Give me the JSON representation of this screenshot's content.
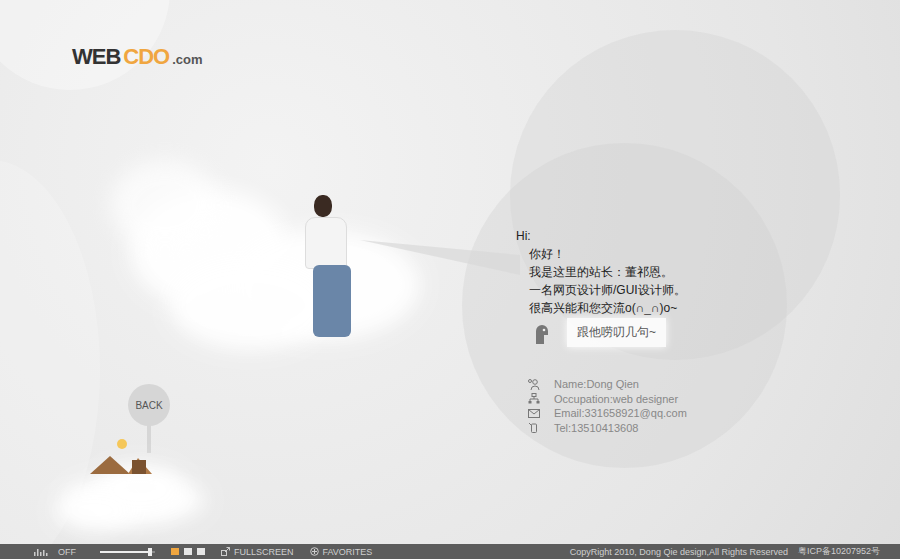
{
  "logo": {
    "prefix": "WEB",
    "mark": "CDO",
    "suffix": ".com"
  },
  "back": {
    "label": "BACK"
  },
  "greeting": {
    "lines": [
      "Hi:",
      "你好！",
      "我是这里的站长：董祁恩。",
      "一名网页设计师/GUI设计师。",
      "很高兴能和您交流o(∩_∩)o~"
    ]
  },
  "chat_button": {
    "label": "跟他唠叨几句~"
  },
  "profile": [
    {
      "kind": "name",
      "text": "Name:Dong Qien"
    },
    {
      "kind": "occupation",
      "text": "Occupation:web designer"
    },
    {
      "kind": "email",
      "text": "Email:331658921@qq.com"
    },
    {
      "kind": "tel",
      "text": "Tel:13510413608"
    }
  ],
  "footer": {
    "sound": {
      "label": "OFF"
    },
    "volume": {
      "level": 0.9
    },
    "view_modes": [
      {
        "selected": true
      },
      {
        "selected": false
      },
      {
        "selected": false
      }
    ],
    "links": [
      {
        "kind": "fullscreen",
        "label": "FULLSCREEN"
      },
      {
        "kind": "favorites",
        "label": "FAVORITES"
      }
    ],
    "copyright": "CopyRight 2010, Dong Qie design,All Rights Reserved",
    "icp": "粤ICP备10207952号"
  }
}
